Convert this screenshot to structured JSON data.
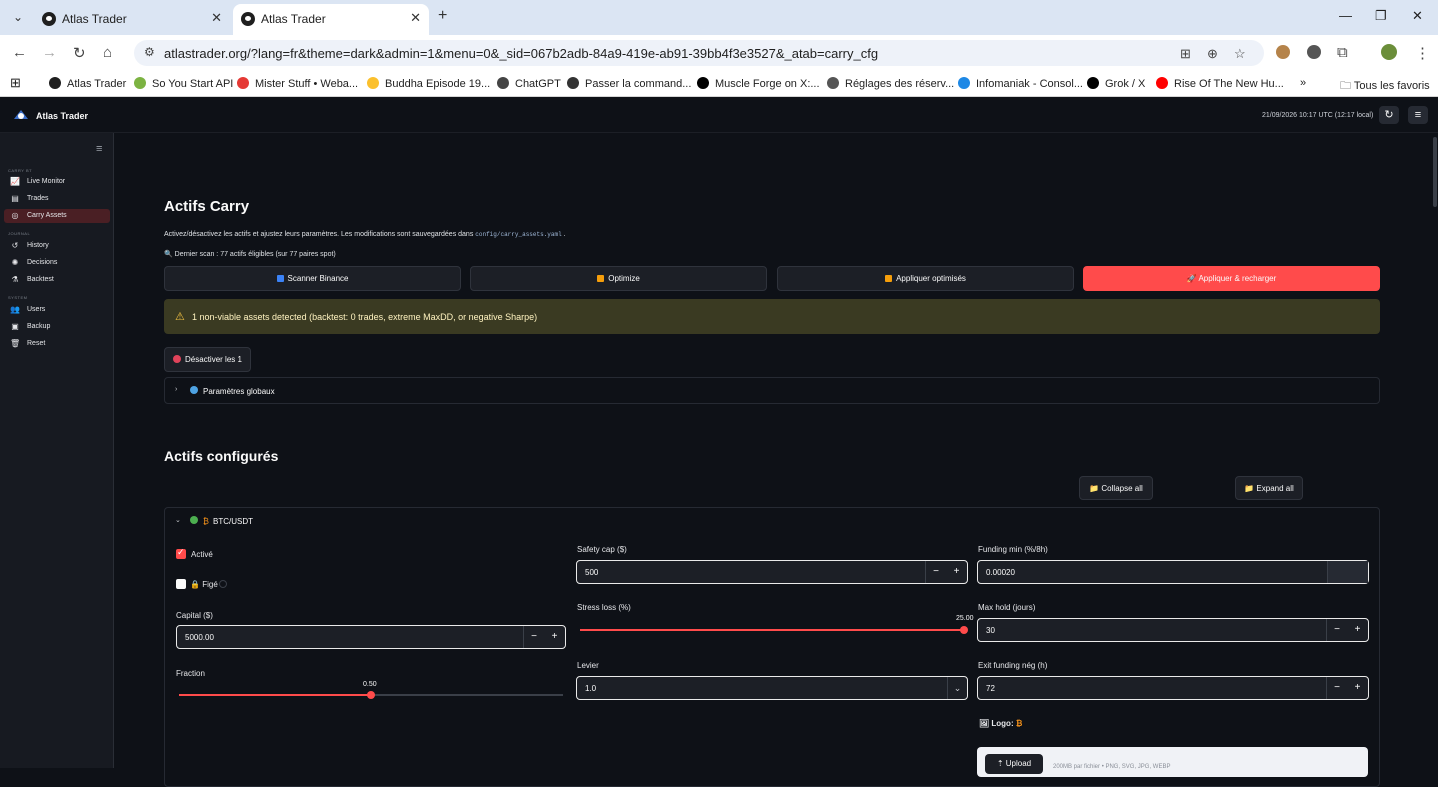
{
  "browser": {
    "tabs": [
      {
        "title": "Atlas Trader"
      },
      {
        "title": "Atlas Trader"
      }
    ],
    "url": "atlastrader.org/?lang=fr&theme=dark&admin=1&menu=0&_sid=067b2adb-84a9-419e-ab91-39bb4f3e3527&_atab=carry_cfg",
    "bookmarks": [
      {
        "label": "Atlas Trader",
        "color": "#1f1f1f"
      },
      {
        "label": "So You Start API",
        "color": "#7cb342"
      },
      {
        "label": "Mister Stuff • Weba...",
        "color": "#e53935"
      },
      {
        "label": "Buddha Episode 19...",
        "color": "#fbc02d"
      },
      {
        "label": "ChatGPT",
        "color": "#444444"
      },
      {
        "label": "Passer la command...",
        "color": "#333333"
      },
      {
        "label": "Muscle Forge on X:...",
        "color": "#000000"
      },
      {
        "label": "Réglages des réserv...",
        "color": "#555555"
      },
      {
        "label": "Infomaniak - Consol...",
        "color": "#1e88e5"
      },
      {
        "label": "Grok / X",
        "color": "#000000"
      },
      {
        "label": "Rise Of The New Hu...",
        "color": "#ff0000"
      }
    ],
    "more_bookmarks": "»",
    "all_bookmarks": "Tous les favoris"
  },
  "app": {
    "title": "Atlas Trader",
    "timestamp": "21/09/2026 10:17 UTC (12:17 local)"
  },
  "sidebar": {
    "sections": [
      {
        "title": "CARRY BT",
        "items": [
          {
            "label": "Live Monitor",
            "icon": "line-chart-icon"
          },
          {
            "label": "Trades",
            "icon": "document-icon"
          },
          {
            "label": "Carry Assets",
            "icon": "coins-icon",
            "active": true
          }
        ]
      },
      {
        "title": "JOURNAL",
        "items": [
          {
            "label": "History",
            "icon": "history-icon"
          },
          {
            "label": "Decisions",
            "icon": "brain-icon"
          },
          {
            "label": "Backtest",
            "icon": "flask-icon"
          }
        ]
      },
      {
        "title": "SYSTEM",
        "items": [
          {
            "label": "Users",
            "icon": "users-icon"
          },
          {
            "label": "Backup",
            "icon": "save-icon"
          },
          {
            "label": "Reset",
            "icon": "trash-icon"
          }
        ]
      }
    ]
  },
  "main": {
    "title": "Actifs Carry",
    "description": "Activez/désactivez les actifs et ajustez leurs paramètres. Les modifications sont sauvegardées dans",
    "config_path": "config/carry_assets.yaml",
    "description_end": ".",
    "scan_info": "Dernier scan : 77 actifs éligibles (sur 77 paires spot)",
    "buttons": {
      "scan": "Scanner Binance",
      "optimize": "Optimize",
      "apply_optimized": "Appliquer optimisés",
      "apply_reload": "Appliquer & recharger"
    },
    "warning": "1 non-viable assets detected (backtest: 0 trades, extreme MaxDD, or negative Sharpe)",
    "deactivate_button": "Désactiver les 1",
    "global_params": "Paramètres globaux",
    "configured_title": "Actifs configurés",
    "collapse_all": "Collapse all",
    "expand_all": "Expand all"
  },
  "asset": {
    "name": "BTC/USDT",
    "active_label": "Activé",
    "active": true,
    "frozen_label": "Figé",
    "frozen": false,
    "capital_label": "Capital ($)",
    "capital": "5000.00",
    "fraction_label": "Fraction",
    "fraction": 0.5,
    "fraction_text": "0.50",
    "safety_cap_label": "Safety cap ($)",
    "safety_cap": "500",
    "stress_loss_label": "Stress loss (%)",
    "stress_loss": 25.0,
    "stress_loss_text": "25.00",
    "leverage_label": "Levier",
    "leverage": "1.0",
    "funding_min_label": "Funding min (%/8h)",
    "funding_min": "0.00020",
    "max_hold_label": "Max hold (jours)",
    "max_hold": "30",
    "exit_funding_label": "Exit funding nég (h)",
    "exit_funding": "72",
    "logo_label": "Logo:",
    "upload_label": "Upload",
    "upload_hint": "200MB par fichier • PNG, SVG, JPG, WEBP"
  },
  "colors": {
    "accent": "#ff4b4b",
    "background": "#0e1117",
    "sidebar": "#171a21",
    "warning_bg": "#3a3a22"
  }
}
